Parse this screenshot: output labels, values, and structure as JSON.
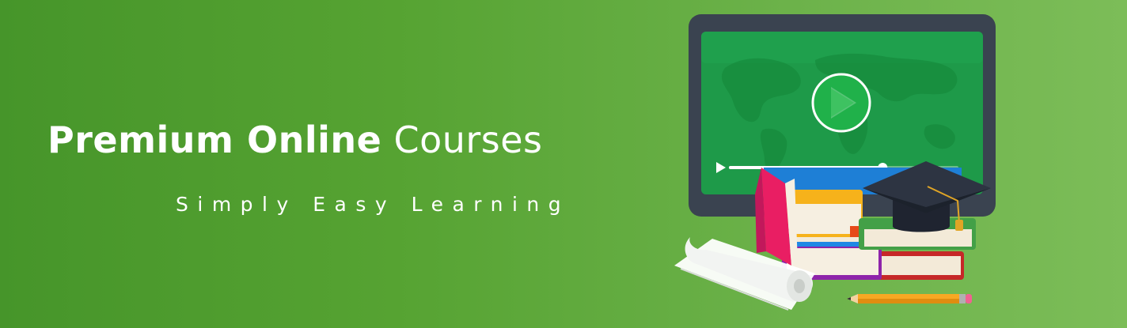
{
  "banner": {
    "title_strong": "Premium Online",
    "title_light": "Courses",
    "tagline": "Simply Easy Learning"
  },
  "video": {
    "progress": 0.67
  },
  "colors": {
    "background_start": "#46952a",
    "background_end": "#7cbd58",
    "screen": "#1e9a49",
    "monitor_frame": "#3a4350",
    "text": "#ffffff"
  },
  "icons": [
    "play-icon",
    "world-map-icon",
    "graduation-cap-icon",
    "books-icon",
    "paper-scroll-icon",
    "pencil-icon"
  ]
}
